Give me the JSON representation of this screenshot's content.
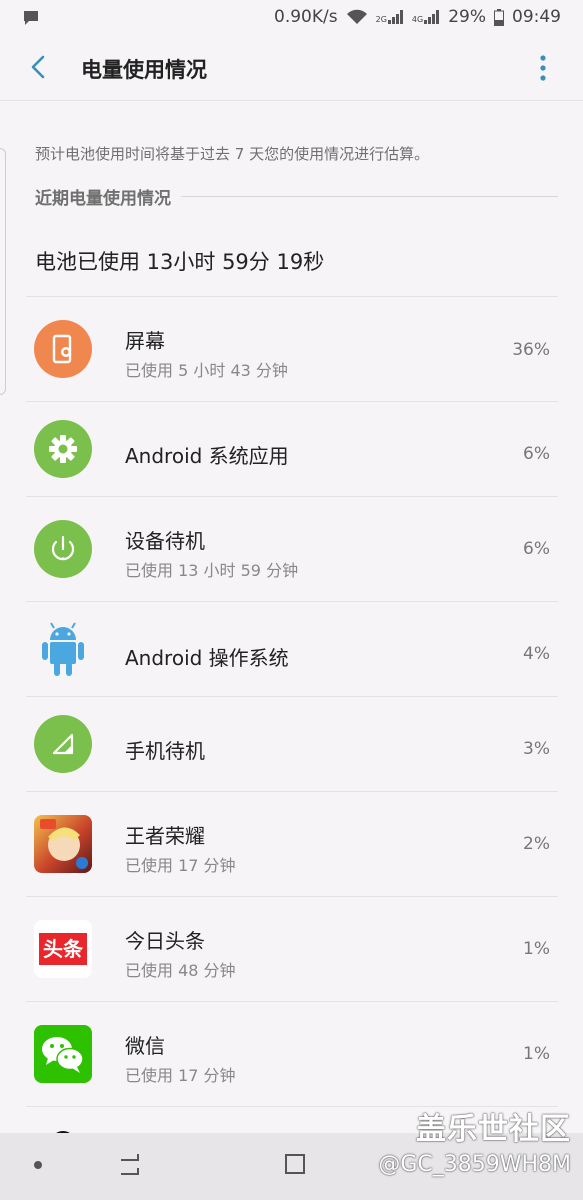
{
  "status_bar": {
    "speed": "0.90K/s",
    "network_label": "2G",
    "network_label2": "4G",
    "battery": "29%",
    "time": "09:49"
  },
  "header": {
    "title": "电量使用情况"
  },
  "note": "预计电池使用时间将基于过去 7 天您的使用情况进行估算。",
  "section_title": "近期电量使用情况",
  "total_usage": "电池已使用 13小时 59分 19秒",
  "items": [
    {
      "name": "屏幕",
      "sub": "已使用 5 小时 43 分钟",
      "percent": "36%",
      "icon": "screen-icon",
      "color": "#f0874f"
    },
    {
      "name": "Android 系统应用",
      "sub": "",
      "percent": "6%",
      "icon": "gear-icon",
      "color": "#7bbf4c"
    },
    {
      "name": "设备待机",
      "sub": "已使用 13 小时 59 分钟",
      "percent": "6%",
      "icon": "power-icon",
      "color": "#7bbf4c"
    },
    {
      "name": "Android 操作系统",
      "sub": "",
      "percent": "4%",
      "icon": "android-icon",
      "color": "#4aa7e0"
    },
    {
      "name": "手机待机",
      "sub": "",
      "percent": "3%",
      "icon": "signal-icon",
      "color": "#7bbf4c"
    },
    {
      "name": "王者荣耀",
      "sub": "已使用 17 分钟",
      "percent": "2%",
      "icon": "game-app-icon",
      "color": "#c8432a"
    },
    {
      "name": "今日头条",
      "sub": "已使用 48 分钟",
      "percent": "1%",
      "icon": "toutiao-app-icon",
      "color": "#e8262c"
    },
    {
      "name": "微信",
      "sub": "已使用 17 分钟",
      "percent": "1%",
      "icon": "wechat-app-icon",
      "color": "#2dc100"
    }
  ],
  "toutiao_logo_text": "头条",
  "watermark": {
    "line1": "盖乐世社区",
    "line2": "@GC_3859WH8M"
  }
}
